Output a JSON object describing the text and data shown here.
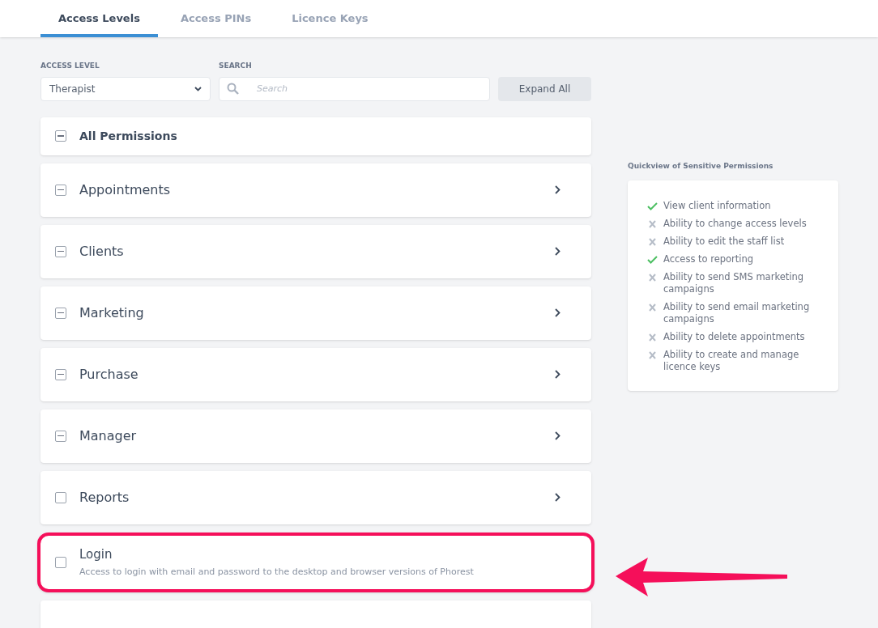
{
  "tabs": [
    {
      "label": "Access Levels",
      "selected": true
    },
    {
      "label": "Access PINs",
      "selected": false
    },
    {
      "label": "Licence Keys",
      "selected": false
    }
  ],
  "filters": {
    "access_level": {
      "label": "ACCESS LEVEL",
      "value": "Therapist"
    },
    "search": {
      "label": "SEARCH",
      "placeholder": "Search"
    },
    "expand_button": "Expand All"
  },
  "all_permissions": {
    "label": "All Permissions",
    "indeterminate": true
  },
  "permissions": [
    {
      "kind": "category",
      "label": "Appointments",
      "indeterminate": true,
      "highlighted": false
    },
    {
      "kind": "category",
      "label": "Clients",
      "indeterminate": true,
      "highlighted": false
    },
    {
      "kind": "category",
      "label": "Marketing",
      "indeterminate": true,
      "highlighted": false
    },
    {
      "kind": "category",
      "label": "Purchase",
      "indeterminate": true,
      "highlighted": false
    },
    {
      "kind": "category",
      "label": "Manager",
      "indeterminate": true,
      "highlighted": false
    },
    {
      "kind": "category",
      "label": "Reports",
      "indeterminate": false,
      "highlighted": false
    },
    {
      "kind": "permission",
      "label": "Login",
      "description": "Access to login with email and password to the desktop and browser versions of Phorest",
      "indeterminate": false,
      "highlighted": true
    }
  ],
  "quickview": {
    "title": "Quickview of Sensitive Permissions",
    "items": [
      {
        "label": "View client information",
        "allowed": true
      },
      {
        "label": "Ability to change access levels",
        "allowed": false
      },
      {
        "label": "Ability to edit the staff list",
        "allowed": false
      },
      {
        "label": "Access to reporting",
        "allowed": true
      },
      {
        "label": "Ability to send SMS marketing campaigns",
        "allowed": false
      },
      {
        "label": "Ability to send email marketing campaigns",
        "allowed": false
      },
      {
        "label": "Ability to delete appointments",
        "allowed": false
      },
      {
        "label": "Ability to create and manage licence keys",
        "allowed": false
      }
    ]
  }
}
